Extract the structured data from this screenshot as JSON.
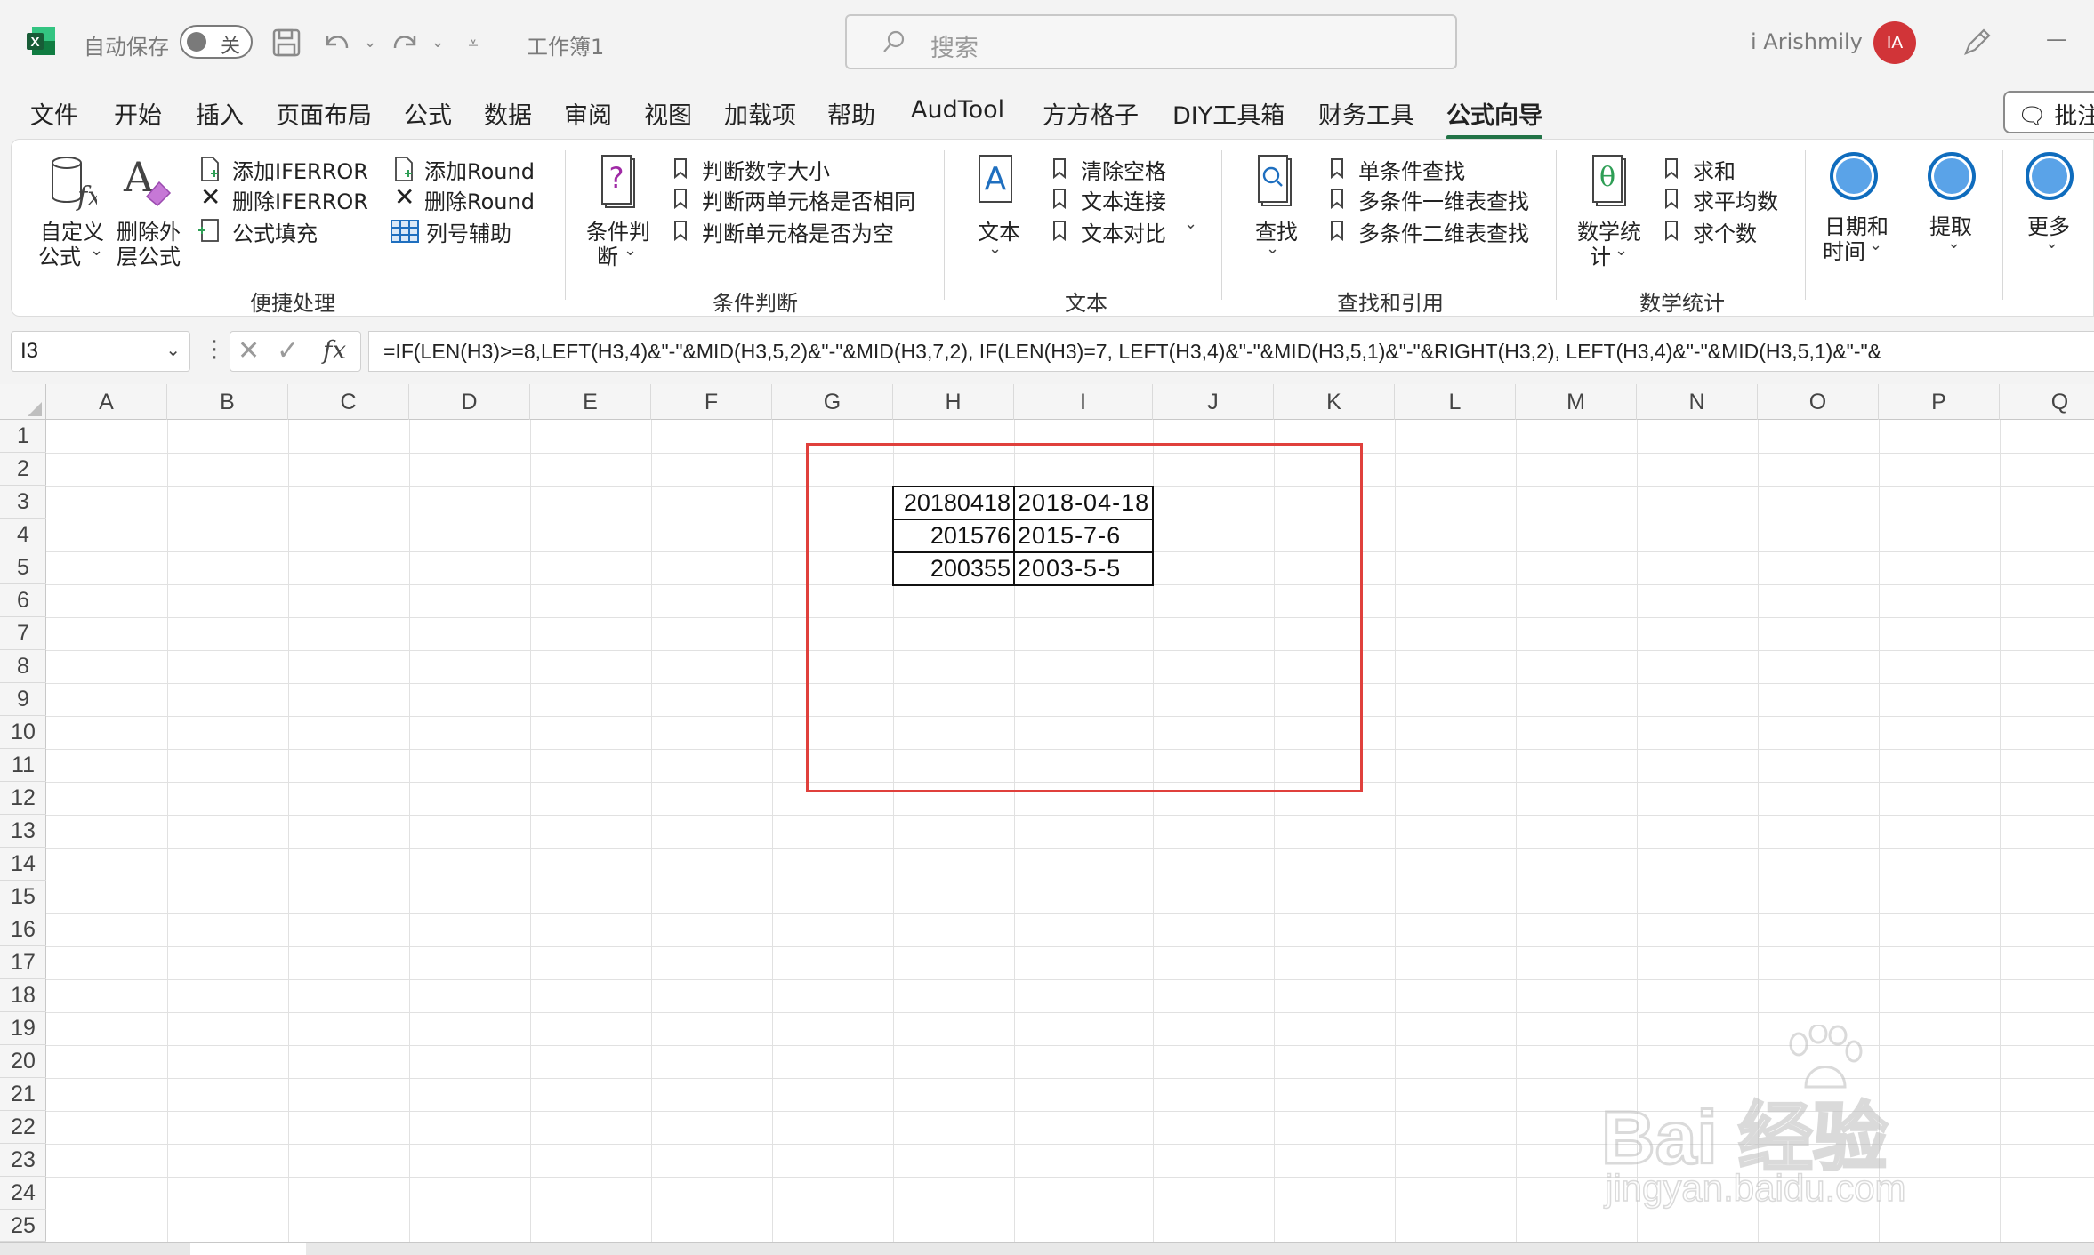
{
  "titlebar": {
    "autosave_label": "自动保存",
    "toggle_state": "关",
    "doc_title": "工作簿1",
    "search_placeholder": "搜索",
    "user_name": "i Arishmily",
    "user_initials": "IA",
    "minimize": "—"
  },
  "tabs": [
    "文件",
    "开始",
    "插入",
    "页面布局",
    "公式",
    "数据",
    "审阅",
    "视图",
    "加载项",
    "帮助",
    "AudTool",
    "方方格子",
    "DIY工具箱",
    "财务工具",
    "公式向导"
  ],
  "active_tab": "公式向导",
  "comment_button": "批注",
  "ribbon": {
    "group1": {
      "label": "便捷处理",
      "big1_line1": "自定义",
      "big1_line2": "公式",
      "big2_line1": "删除外",
      "big2_line2": "层公式",
      "items": [
        "添加IFERROR",
        "删除IFERROR",
        "公式填充",
        "添加Round",
        "删除Round",
        "列号辅助"
      ]
    },
    "group2": {
      "label": "条件判断",
      "big_line1": "条件判",
      "big_line2": "断",
      "items": [
        "判断数字大小",
        "判断两单元格是否相同",
        "判断单元格是否为空"
      ]
    },
    "group3": {
      "label": "文本",
      "big_label": "文本",
      "items": [
        "清除空格",
        "文本连接",
        "文本对比"
      ]
    },
    "group4": {
      "label": "查找和引用",
      "big_label": "查找",
      "items": [
        "单条件查找",
        "多条件一维表查找",
        "多条件二维表查找"
      ]
    },
    "group5": {
      "label": "数学统计",
      "big_line1": "数学统",
      "big_line2": "计",
      "items": [
        "求和",
        "求平均数",
        "求个数"
      ]
    },
    "group6": {
      "line1": "日期和",
      "line2": "时间"
    },
    "group7": {
      "label": "提取"
    },
    "group8": {
      "label": "更多"
    }
  },
  "formula_bar": {
    "name_box": "I3",
    "fx": "fx",
    "formula": "=IF(LEN(H3)>=8,LEFT(H3,4)&\"-\"&MID(H3,5,2)&\"-\"&MID(H3,7,2), IF(LEN(H3)=7, LEFT(H3,4)&\"-\"&MID(H3,5,1)&\"-\"&RIGHT(H3,2),  LEFT(H3,4)&\"-\"&MID(H3,5,1)&\"-\"&"
  },
  "grid": {
    "columns": [
      "A",
      "B",
      "C",
      "D",
      "E",
      "F",
      "G",
      "H",
      "I",
      "J",
      "K",
      "L",
      "M",
      "N",
      "O",
      "P",
      "Q"
    ],
    "rows": [
      "1",
      "2",
      "3",
      "4",
      "5",
      "6",
      "7",
      "8",
      "9",
      "10",
      "11",
      "12",
      "13",
      "14",
      "15",
      "16",
      "17",
      "18",
      "19",
      "20",
      "21",
      "22",
      "23",
      "24",
      "25"
    ],
    "table": [
      {
        "h": "20180418",
        "i": "2018-04-18"
      },
      {
        "h": "201576",
        "i": "2015-7-6"
      },
      {
        "h": "200355",
        "i": "2003-5-5"
      }
    ]
  },
  "watermark": {
    "main": "Bai 经验",
    "sub": "jingyan.baidu.com"
  },
  "colors": {
    "accent": "#217346",
    "highlight": "#e0403c",
    "avatar": "#d13438",
    "icon_blue": "#0f6cbd"
  }
}
